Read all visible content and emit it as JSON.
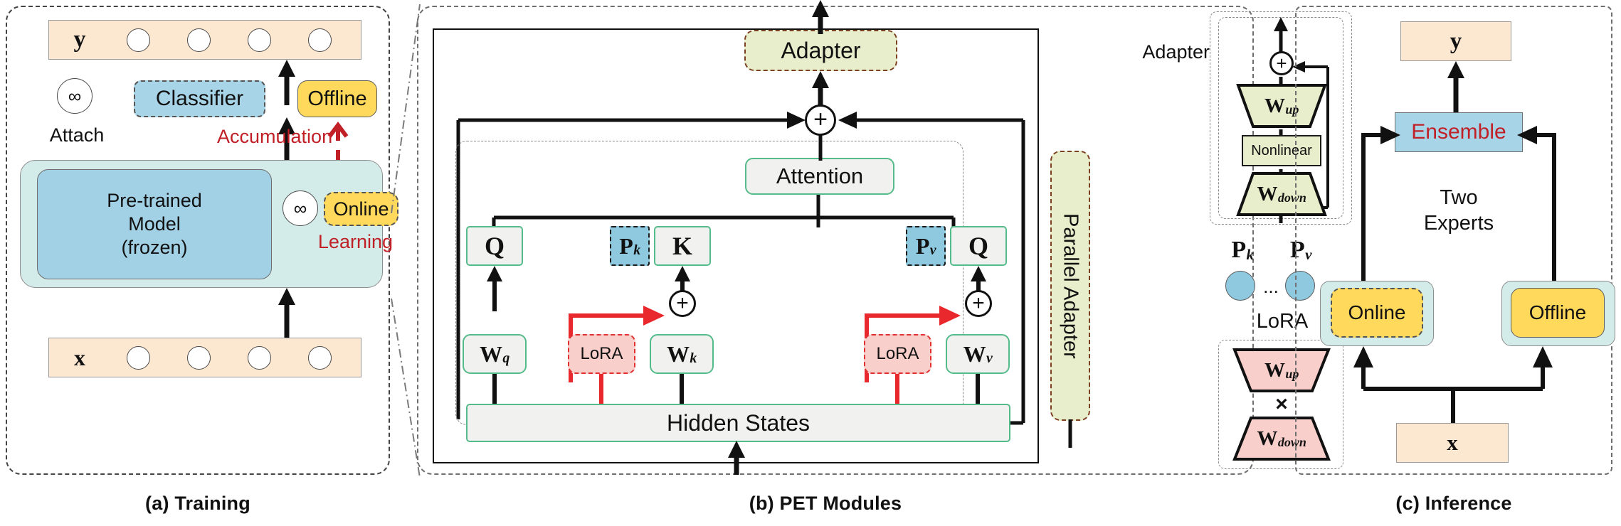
{
  "figure": {
    "panels": [
      {
        "id": "a",
        "caption": "(a) Training"
      },
      {
        "id": "b",
        "caption": "(b) PET Modules"
      },
      {
        "id": "c",
        "caption": "(c) Inference"
      }
    ],
    "colors": {
      "peach": "#fce7d0",
      "light_blue": "#a8d4e8",
      "mint": "#d3ecea",
      "yellow": "#ffd95c",
      "green_outline": "#56bb8a",
      "olive": "#e8eecb",
      "pink": "#f8cfcb",
      "red_accent": "#c02026",
      "brown_dash": "#7b3f22"
    }
  },
  "training": {
    "output_label": "y",
    "input_label": "x",
    "classifier": "Classifier",
    "pretrained": "Pre-trained\nModel\n(frozen)",
    "pretrained_line1": "Pre-trained",
    "pretrained_line2": "Model",
    "pretrained_line3": "(frozen)",
    "attach": "Attach",
    "accumulation": "Accumulation",
    "learning": "Learning",
    "offline": "Offline",
    "online": "Online",
    "infinity_glyph": "∞",
    "token_count": 4
  },
  "pet": {
    "adapter_top": "Adapter",
    "attention": "Attention",
    "hidden_states": "Hidden States",
    "parallel_adapter": "Parallel Adapter",
    "plus_glyph": "+",
    "q_left": "Q",
    "k_center": "K",
    "q_right": "Q",
    "p_k": "P",
    "p_k_sub": "k",
    "p_v": "P",
    "p_v_sub": "v",
    "w_q": "W",
    "w_q_sub": "q",
    "w_k": "W",
    "w_k_sub": "k",
    "w_v": "W",
    "w_v_sub": "v",
    "lora_left": "LoRA",
    "lora_right": "LoRA"
  },
  "legend": {
    "adapter_title": "Adapter",
    "adapter_w_up": "W",
    "adapter_w_up_sub": "up",
    "adapter_nonlinear": "Nonlinear",
    "adapter_w_down": "W",
    "adapter_w_down_sub": "down",
    "prompt_p_k": "P",
    "prompt_p_k_sub": "k",
    "prompt_p_v": "P",
    "prompt_p_v_sub": "v",
    "prompt_ellipsis": "...",
    "lora_title": "LoRA",
    "lora_w_up": "W",
    "lora_w_up_sub": "up",
    "lora_times": "×",
    "lora_w_down": "W",
    "lora_w_down_sub": "down"
  },
  "inference": {
    "output_label": "y",
    "input_label": "x",
    "ensemble": "Ensemble",
    "two_experts_line1": "Two",
    "two_experts_line2": "Experts",
    "online": "Online",
    "offline": "Offline"
  }
}
